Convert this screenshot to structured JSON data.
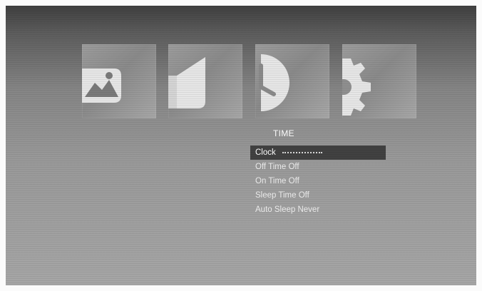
{
  "menu_tabs": [
    {
      "icon": "photo-icon"
    },
    {
      "icon": "speaker-icon"
    },
    {
      "icon": "clock-icon"
    },
    {
      "icon": "gear-icon"
    }
  ],
  "time_menu": {
    "title": "TIME",
    "items": [
      {
        "label": "Clock",
        "value": ""
      },
      {
        "label": "Off Time",
        "value": "Off"
      },
      {
        "label": "On Time",
        "value": "Off"
      },
      {
        "label": "Sleep Time",
        "value": "Off"
      },
      {
        "label": "Auto Sleep",
        "value": "Never"
      }
    ],
    "selected_index": 0
  }
}
